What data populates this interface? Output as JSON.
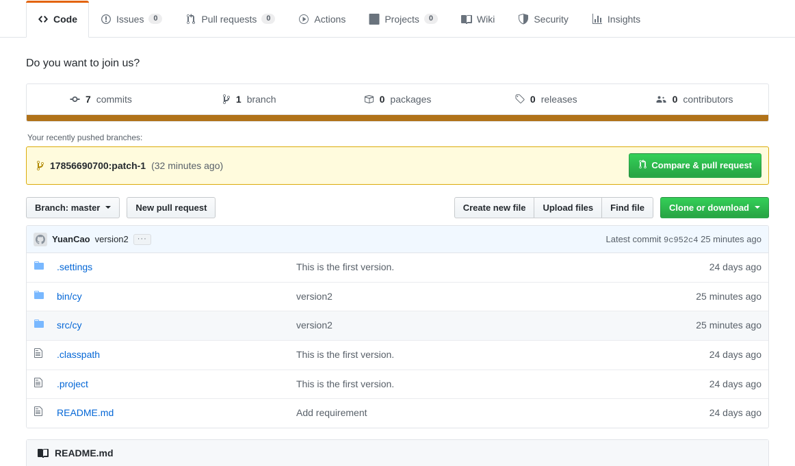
{
  "repo_nav": {
    "tabs": [
      {
        "label": "Code",
        "icon": "code-icon",
        "count": null,
        "selected": true
      },
      {
        "label": "Issues",
        "icon": "issue-icon",
        "count": "0",
        "selected": false
      },
      {
        "label": "Pull requests",
        "icon": "pr-icon",
        "count": "0",
        "selected": false
      },
      {
        "label": "Actions",
        "icon": "play-icon",
        "count": null,
        "selected": false
      },
      {
        "label": "Projects",
        "icon": "project-icon",
        "count": "0",
        "selected": false
      },
      {
        "label": "Wiki",
        "icon": "book-icon",
        "count": null,
        "selected": false
      },
      {
        "label": "Security",
        "icon": "shield-icon",
        "count": null,
        "selected": false
      },
      {
        "label": "Insights",
        "icon": "graph-icon",
        "count": null,
        "selected": false
      }
    ]
  },
  "repo_description": "Do you want to join us?",
  "overall": {
    "stats": [
      {
        "num": "7",
        "label": "commits",
        "icon": "commit-icon"
      },
      {
        "num": "1",
        "label": "branch",
        "icon": "branch-icon"
      },
      {
        "num": "0",
        "label": "packages",
        "icon": "package-icon"
      },
      {
        "num": "0",
        "label": "releases",
        "icon": "tag-icon"
      },
      {
        "num": "0",
        "label": "contributors",
        "icon": "people-icon"
      }
    ],
    "language_bar": [
      {
        "color": "#b07219",
        "percent": 100
      }
    ]
  },
  "pushed_branches": {
    "label": "Your recently pushed branches:",
    "branch": "17856690700:patch-1",
    "time": "(32 minutes ago)",
    "compare_button": "Compare & pull request",
    "branch_icon": "branch-icon",
    "compare_icon": "pr-icon"
  },
  "file_nav": {
    "branch_button": "Branch: master",
    "new_pull_request": "New pull request",
    "create_new_file": "Create new file",
    "upload_files": "Upload files",
    "find_file": "Find file",
    "clone_or_download": "Clone or download"
  },
  "commit_tease": {
    "avatar_icon": "octocat-avatar",
    "author": "YuanCao",
    "message": "version2",
    "ellipsis": "···",
    "latest_commit_label": "Latest commit",
    "sha": "9c952c4",
    "time": "25 minutes ago"
  },
  "files": {
    "rows": [
      {
        "icon": "folder-icon",
        "type": "folder",
        "name": ".settings",
        "message": "This is the first version.",
        "age": "24 days ago",
        "highlighted": false
      },
      {
        "icon": "folder-icon",
        "type": "folder",
        "name": "bin/cy",
        "message": "version2",
        "age": "25 minutes ago",
        "highlighted": false
      },
      {
        "icon": "folder-icon",
        "type": "folder",
        "name": "src/cy",
        "message": "version2",
        "age": "25 minutes ago",
        "highlighted": true
      },
      {
        "icon": "file-icon",
        "type": "file",
        "name": ".classpath",
        "message": "This is the first version.",
        "age": "24 days ago",
        "highlighted": false
      },
      {
        "icon": "file-icon",
        "type": "file",
        "name": ".project",
        "message": "This is the first version.",
        "age": "24 days ago",
        "highlighted": false
      },
      {
        "icon": "file-icon",
        "type": "file",
        "name": "README.md",
        "message": "Add requirement",
        "age": "24 days ago",
        "highlighted": false
      }
    ]
  },
  "readme": {
    "title": "README.md",
    "icon": "book-icon"
  },
  "colors": {
    "accent_orange": "#e36209",
    "link_blue": "#0366d6",
    "green_button": "#28a745",
    "language_java": "#b07219",
    "notice_yellow_bg": "#fffbdd",
    "notice_yellow_border": "#dbab09"
  }
}
